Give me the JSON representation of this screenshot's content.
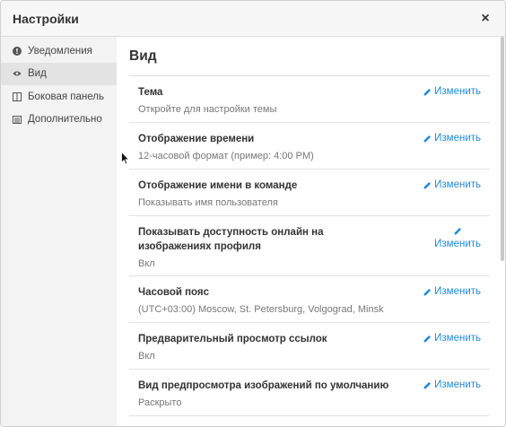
{
  "dialog": {
    "title": "Настройки",
    "close_symbol": "×"
  },
  "sidebar": {
    "items": [
      {
        "label": "Уведомления",
        "icon": "info-circle-icon"
      },
      {
        "label": "Вид",
        "icon": "eye-icon",
        "active": true
      },
      {
        "label": "Боковая панель",
        "icon": "columns-icon"
      },
      {
        "label": "Дополнительно",
        "icon": "list-icon"
      }
    ]
  },
  "main": {
    "section_title": "Вид",
    "edit_label": "Изменить",
    "settings": [
      {
        "title": "Тема",
        "value": "Откройте для настройки темы"
      },
      {
        "title": "Отображение времени",
        "value": "12-часовой формат (пример: 4:00 PM)"
      },
      {
        "title": "Отображение имени в команде",
        "value": "Показывать имя пользователя"
      },
      {
        "title": "Показывать доступность онлайн на изображениях профиля",
        "value": "Вкл"
      },
      {
        "title": "Часовой пояс",
        "value": "(UTC+03:00) Moscow, St. Petersburg, Volgograd, Minsk"
      },
      {
        "title": "Предварительный просмотр ссылок",
        "value": "Вкл"
      },
      {
        "title": "Вид предпросмотра изображений по умолчанию",
        "value": "Раскрыто"
      }
    ]
  },
  "colors": {
    "accent": "#2389d7",
    "sidebar_bg": "#f3f3f3",
    "active_bg": "#e3e3e3"
  }
}
